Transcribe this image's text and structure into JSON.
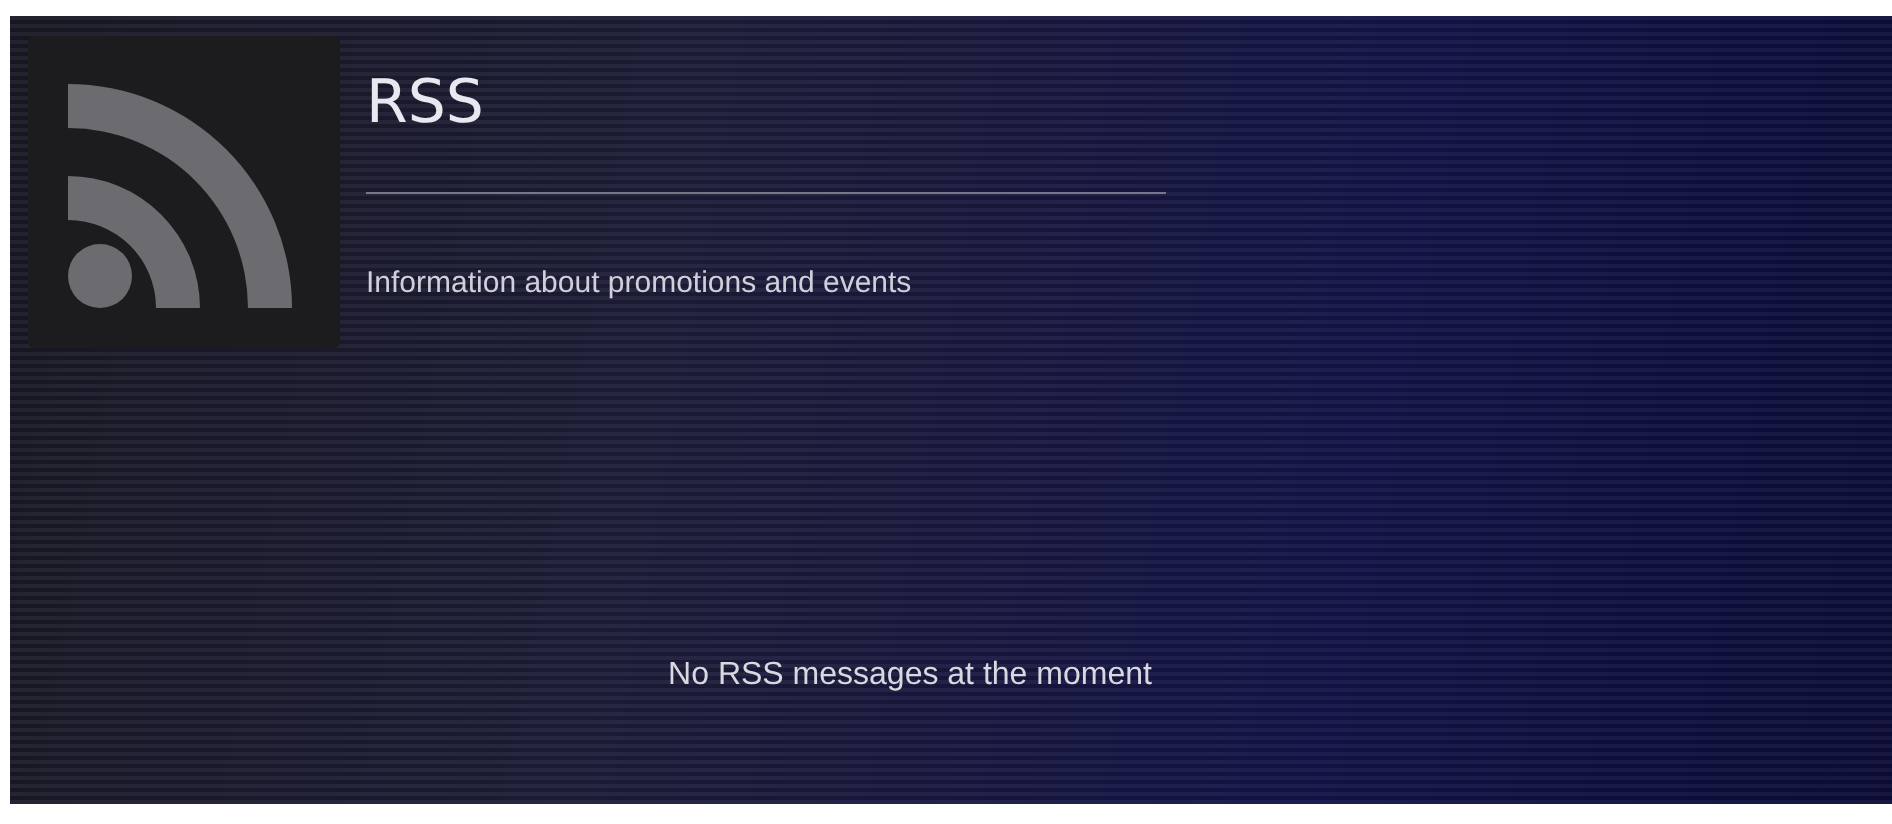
{
  "header": {
    "title": "RSS",
    "subtitle": "Information about promotions and events"
  },
  "message": "No RSS messages at the moment"
}
